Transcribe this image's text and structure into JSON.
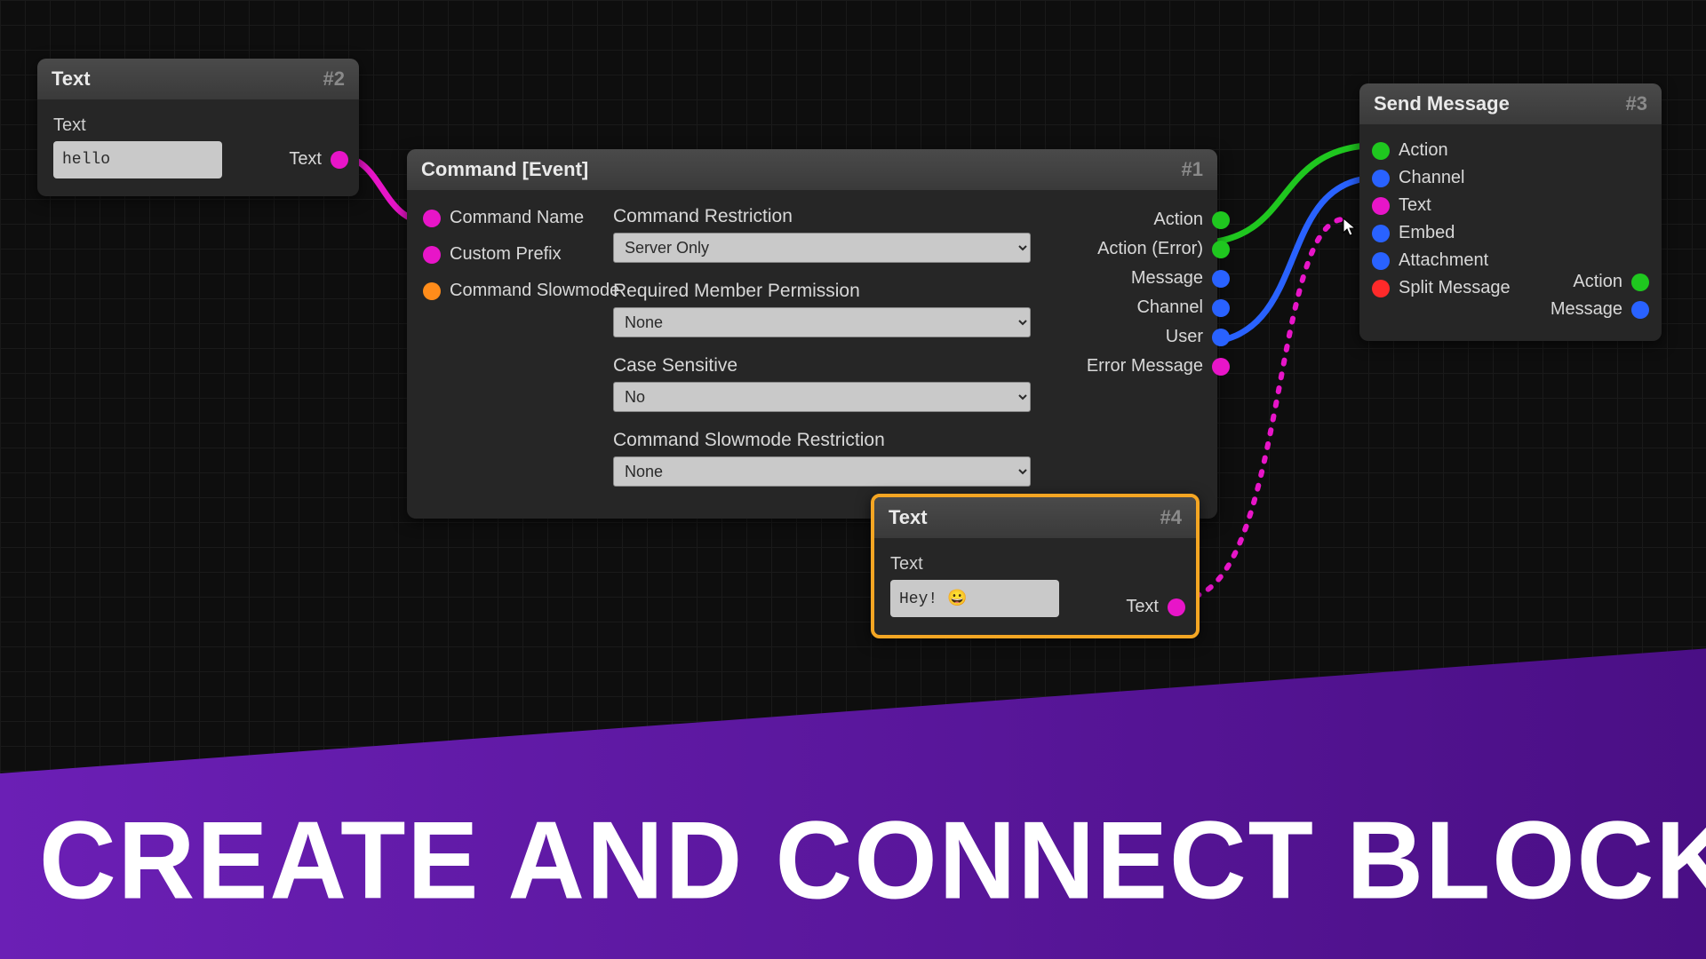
{
  "banner": {
    "headline": "CREATE AND CONNECT BLOCKS"
  },
  "colors": {
    "magenta": "#e815c8",
    "green": "#1fc71f",
    "blue": "#2962ff",
    "orange": "#ff8c1a",
    "red": "#ff2a2a"
  },
  "nodes": {
    "text2": {
      "title": "Text",
      "id": "#2",
      "field_label": "Text",
      "value": "hello",
      "out_port": "Text"
    },
    "command1": {
      "title": "Command [Event]",
      "id": "#1",
      "left_ports": [
        {
          "label": "Command Name",
          "color": "magenta"
        },
        {
          "label": "Custom Prefix",
          "color": "magenta"
        },
        {
          "label": "Command Slowmode",
          "color": "orange"
        }
      ],
      "form": [
        {
          "label": "Command Restriction",
          "value": "Server Only"
        },
        {
          "label": "Required Member Permission",
          "value": "None"
        },
        {
          "label": "Case Sensitive",
          "value": "No"
        },
        {
          "label": "Command Slowmode Restriction",
          "value": "None"
        }
      ],
      "right_ports": [
        {
          "label": "Action",
          "color": "green"
        },
        {
          "label": "Action (Error)",
          "color": "green"
        },
        {
          "label": "Message",
          "color": "blue"
        },
        {
          "label": "Channel",
          "color": "blue"
        },
        {
          "label": "User",
          "color": "blue"
        },
        {
          "label": "Error Message",
          "color": "magenta"
        }
      ]
    },
    "text4": {
      "title": "Text",
      "id": "#4",
      "field_label": "Text",
      "value": "Hey! 😀",
      "out_port": "Text",
      "selected": true
    },
    "send3": {
      "title": "Send Message",
      "id": "#3",
      "left_ports": [
        {
          "label": "Action",
          "color": "green"
        },
        {
          "label": "Channel",
          "color": "blue"
        },
        {
          "label": "Text",
          "color": "magenta"
        },
        {
          "label": "Embed",
          "color": "blue"
        },
        {
          "label": "Attachment",
          "color": "blue"
        },
        {
          "label": "Split Message",
          "color": "red"
        }
      ],
      "right_ports": [
        {
          "label": "Action",
          "color": "green"
        },
        {
          "label": "Message",
          "color": "blue"
        }
      ]
    }
  },
  "connections": [
    {
      "from": "text2.Text",
      "to": "command1.Command Name",
      "color": "magenta",
      "style": "solid"
    },
    {
      "from": "command1.Action",
      "to": "send3.Action",
      "color": "green",
      "style": "solid"
    },
    {
      "from": "command1.Channel",
      "to": "send3.Channel",
      "color": "blue",
      "style": "solid"
    },
    {
      "from": "text4.Text",
      "to": "send3.Text",
      "color": "magenta",
      "style": "dotted"
    }
  ]
}
